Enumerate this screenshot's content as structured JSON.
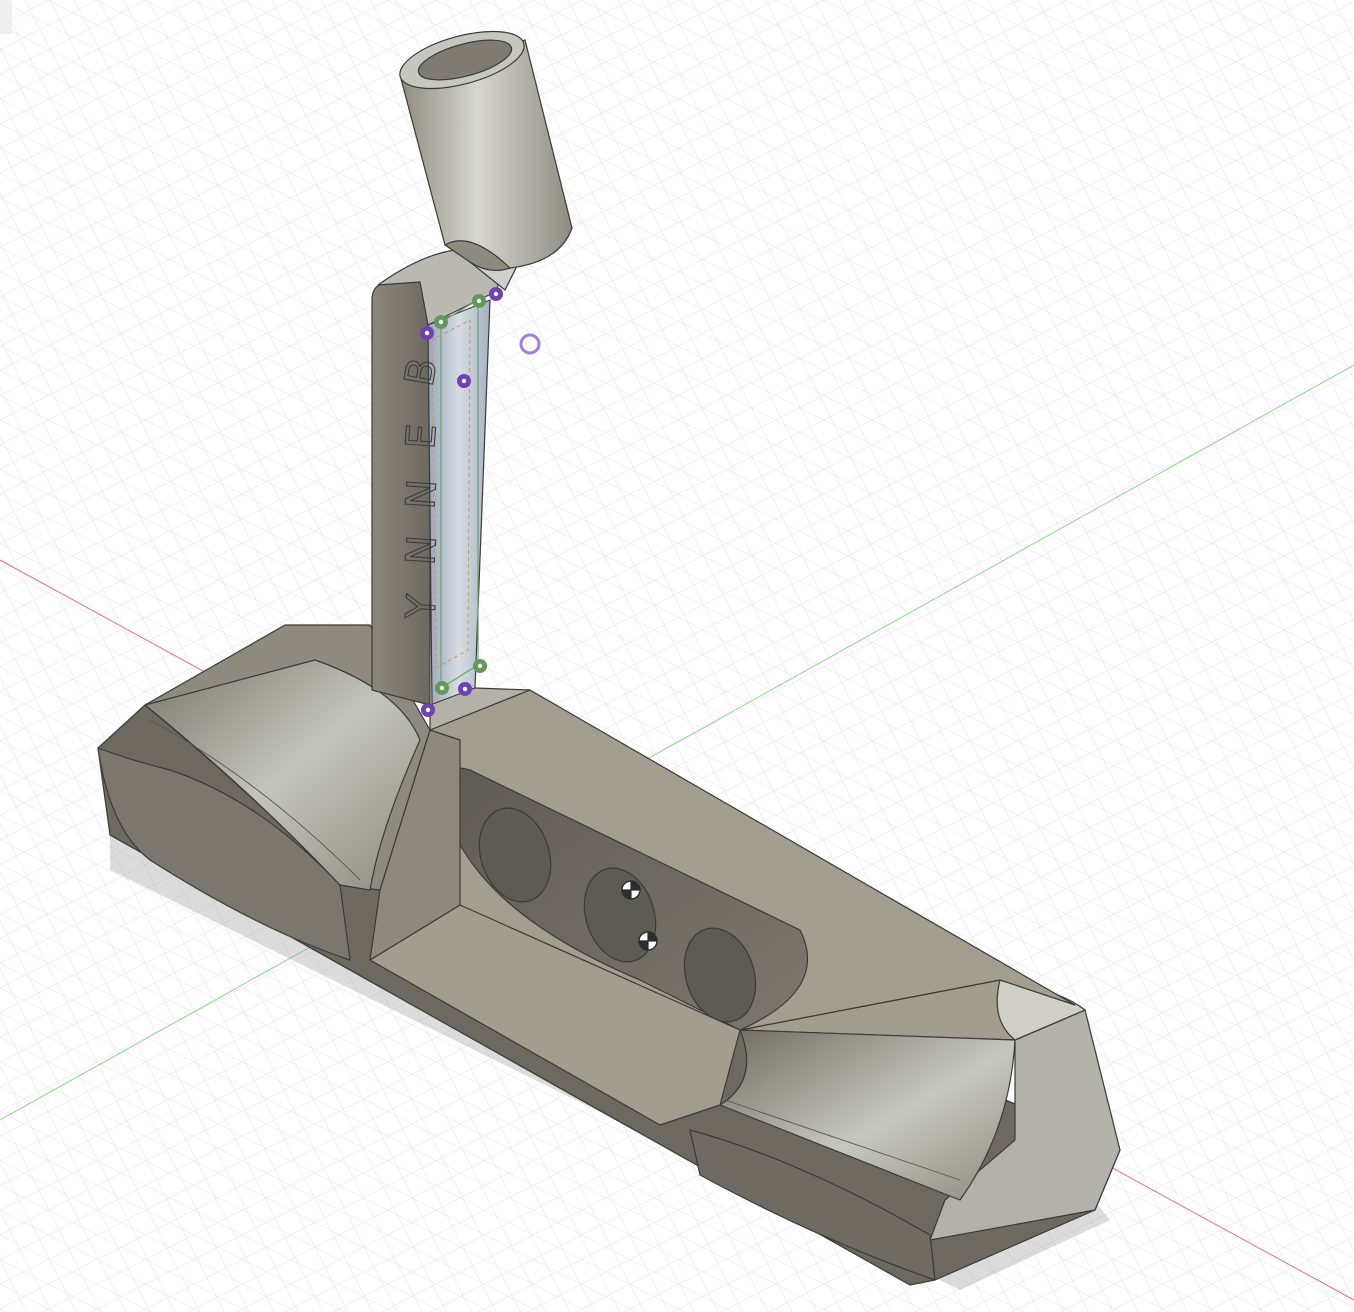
{
  "viewport": {
    "background": "#ffffff",
    "grid_color": "#d4d4d4",
    "axis_x_color": "#e05555",
    "axis_y_color": "#6fd06f"
  },
  "model": {
    "body_color": "#9d978a",
    "highlight_color": "#c9cbc3",
    "shadow_color": "#5d5a55"
  },
  "sketch": {
    "engraving_letters": [
      "B",
      "E",
      "N",
      "N",
      "Y"
    ],
    "constraint_colors": {
      "green": "#6fa36a",
      "purple": "#8a5ec7"
    }
  },
  "markers": {
    "cursor_ring": "cursor-ring",
    "center_point": "center-point-icon"
  }
}
